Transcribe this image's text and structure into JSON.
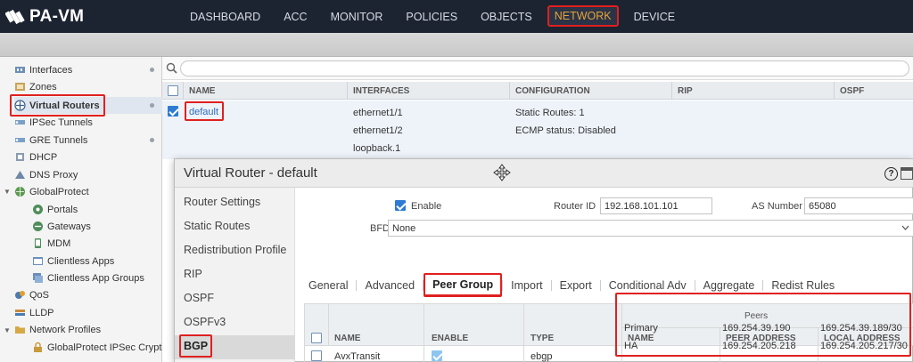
{
  "app": {
    "logo_text": "PA-VM"
  },
  "nav": {
    "tabs": [
      {
        "label": "DASHBOARD"
      },
      {
        "label": "ACC"
      },
      {
        "label": "MONITOR"
      },
      {
        "label": "POLICIES"
      },
      {
        "label": "OBJECTS"
      },
      {
        "label": "NETWORK",
        "active": true
      },
      {
        "label": "DEVICE"
      }
    ]
  },
  "sidebar": {
    "items": [
      {
        "label": "Interfaces",
        "icon": "interfaces-icon"
      },
      {
        "label": "Zones",
        "icon": "zones-icon"
      },
      {
        "label": "Virtual Routers",
        "icon": "router-icon",
        "selected": true
      },
      {
        "label": "IPSec Tunnels",
        "icon": "tunnel-icon"
      },
      {
        "label": "GRE Tunnels",
        "icon": "tunnel-icon"
      },
      {
        "label": "DHCP",
        "icon": "dhcp-icon"
      },
      {
        "label": "DNS Proxy",
        "icon": "dns-icon"
      },
      {
        "label": "GlobalProtect",
        "icon": "globe-icon"
      },
      {
        "label": "Portals",
        "icon": "portal-icon"
      },
      {
        "label": "Gateways",
        "icon": "gateway-icon"
      },
      {
        "label": "MDM",
        "icon": "mdm-icon"
      },
      {
        "label": "Clientless Apps",
        "icon": "app-icon"
      },
      {
        "label": "Clientless App Groups",
        "icon": "app-group-icon"
      },
      {
        "label": "QoS",
        "icon": "qos-icon"
      },
      {
        "label": "LLDP",
        "icon": "lldp-icon"
      },
      {
        "label": "Network Profiles",
        "icon": "folder-icon"
      },
      {
        "label": "GlobalProtect IPSec Crypto",
        "icon": "crypto-icon"
      }
    ]
  },
  "router_table": {
    "columns": [
      "NAME",
      "INTERFACES",
      "CONFIGURATION",
      "RIP",
      "OSPF"
    ],
    "row": {
      "name": "default",
      "interfaces": [
        "ethernet1/1",
        "ethernet1/2",
        "loopback.1"
      ],
      "configuration": [
        "Static Routes: 1",
        "ECMP status: Disabled"
      ]
    }
  },
  "modal": {
    "title": "Virtual Router - default",
    "help": "?",
    "nav": [
      {
        "label": "Router Settings"
      },
      {
        "label": "Static Routes"
      },
      {
        "label": "Redistribution Profile"
      },
      {
        "label": "RIP"
      },
      {
        "label": "OSPF"
      },
      {
        "label": "OSPFv3"
      },
      {
        "label": "BGP",
        "active": true
      }
    ],
    "enable_label": "Enable",
    "router_id_label": "Router ID",
    "router_id": "192.168.101.101",
    "as_number_label": "AS Number",
    "as_number": "65080",
    "bfd_label": "BFD",
    "bfd_value": "None",
    "tabs": [
      {
        "label": "General"
      },
      {
        "label": "Advanced"
      },
      {
        "label": "Peer Group",
        "active": true
      },
      {
        "label": "Import"
      },
      {
        "label": "Export"
      },
      {
        "label": "Conditional Adv"
      },
      {
        "label": "Aggregate"
      },
      {
        "label": "Redist Rules"
      }
    ],
    "peer_group": {
      "columns": {
        "name": "NAME",
        "enable": "ENABLE",
        "type": "TYPE"
      },
      "peers_header": "Peers",
      "peer_columns": {
        "name": "NAME",
        "peer_address": "PEER ADDRESS",
        "local_address": "LOCAL ADDRESS"
      },
      "group": {
        "name": "AvxTransit",
        "enabled": true,
        "type": "ebgp"
      },
      "peers": [
        {
          "name": "Primary",
          "peer_address": "169.254.39.190",
          "local_address": "169.254.39.189/30"
        },
        {
          "name": "HA",
          "peer_address": "169.254.205.218",
          "local_address": "169.254.205.217/30"
        }
      ]
    }
  },
  "colors": {
    "topbar": "#1d2431",
    "active_tab": "#e8a13a",
    "annotation_red": "#e02020",
    "link_blue": "#2d6db5"
  }
}
